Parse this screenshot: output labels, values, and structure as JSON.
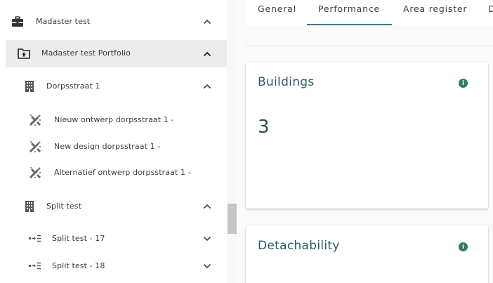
{
  "tree": {
    "items": [
      {
        "label": "Madaster test",
        "icon": "briefcase-icon",
        "chevron": "chevron-up-icon"
      },
      {
        "label": "Madaster test Portfolio",
        "icon": "portfolio-folder-icon",
        "chevron": "chevron-up-icon"
      },
      {
        "label": "Dorpsstraat 1",
        "icon": "building-icon",
        "chevron": "chevron-up-icon"
      },
      {
        "label": "Nieuw ontwerp dorpsstraat 1 -",
        "icon": "design-tools-icon"
      },
      {
        "label": "New design dorpsstraat 1 -",
        "icon": "design-tools-icon"
      },
      {
        "label": "Alternatief ontwerp dorpsstraat 1 -",
        "icon": "design-tools-icon"
      },
      {
        "label": "Split test",
        "icon": "building-icon",
        "chevron": "chevron-up-icon"
      },
      {
        "label": "Split test - 17",
        "icon": "split-icon",
        "chevron": "chevron-down-icon"
      },
      {
        "label": "Split test - 18",
        "icon": "split-icon",
        "chevron": "chevron-down-icon"
      }
    ]
  },
  "tabs": {
    "items": [
      {
        "label": "General"
      },
      {
        "label": "Performance"
      },
      {
        "label": "Area register"
      },
      {
        "label": "D"
      }
    ],
    "active": "Performance"
  },
  "cards": {
    "buildings": {
      "title": "Buildings",
      "value": "3"
    },
    "detachability": {
      "title": "Detachability"
    }
  },
  "colors": {
    "accent": "#2d7e8c",
    "info": "#2e7d57",
    "title": "#2d5b67"
  }
}
